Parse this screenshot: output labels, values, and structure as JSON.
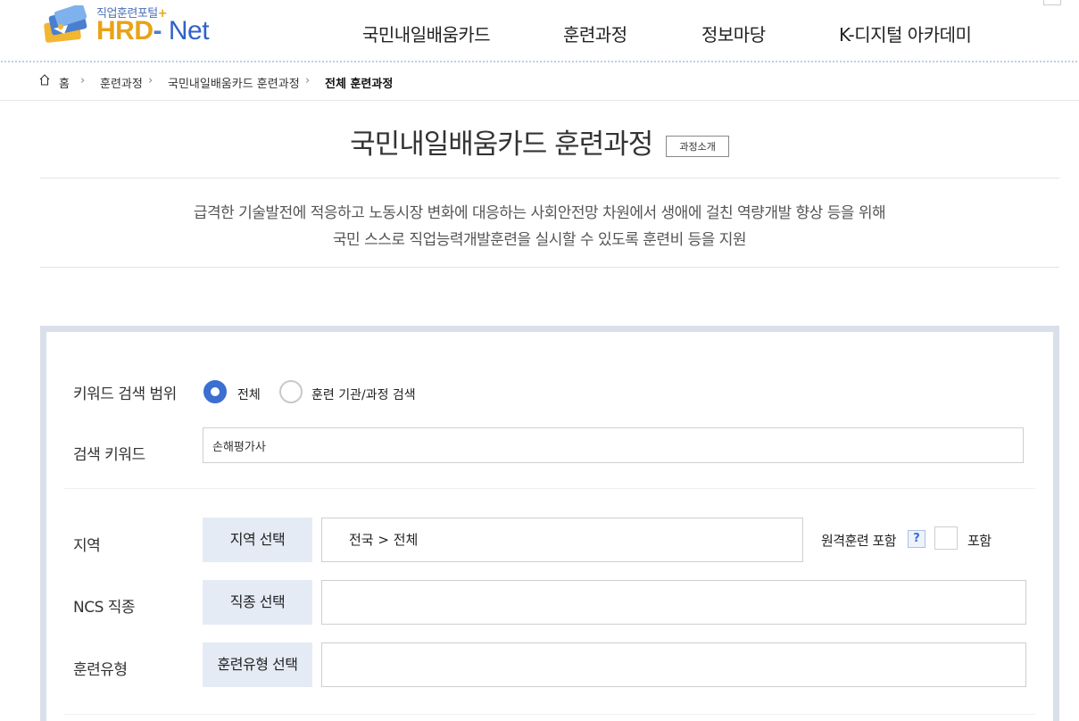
{
  "header": {
    "logo_small": "직업훈련포털",
    "logo_plus": "+",
    "logo_hrd": "HRD",
    "logo_dash": "-",
    "logo_net": "Net",
    "nav": [
      "국민내일배움카드",
      "훈련과정",
      "정보마당",
      "K-디지털 아카데미"
    ]
  },
  "breadcrumb": {
    "home": "홈",
    "items": [
      "훈련과정",
      "국민내일배움카드 훈련과정"
    ],
    "current": "전체 훈련과정"
  },
  "page": {
    "title": "국민내일배움카드 훈련과정",
    "intro_button": "과정소개",
    "desc_line1": "급격한 기술발전에 적응하고 노동시장 변화에 대응하는 사회안전망 차원에서 생애에 걸친 역량개발 향상 등을 위해",
    "desc_line2": "국민 스스로 직업능력개발훈련을 실시할 수 있도록 훈련비 등을 지원"
  },
  "search": {
    "scope_label": "키워드 검색 범위",
    "scope_options": [
      {
        "label": "전체",
        "selected": true
      },
      {
        "label": "훈련 기관/과정 검색",
        "selected": false
      }
    ],
    "keyword_label": "검색 키워드",
    "keyword_value": "손해평가사",
    "region_label": "지역",
    "region_button": "지역 선택",
    "region_value": "전국 > 전체",
    "remote_label": "원격훈련 포함",
    "remote_help": "?",
    "remote_check_label": "포함",
    "remote_checked": false,
    "ncs_label": "NCS 직종",
    "ncs_button": "직종 선택",
    "ncs_value": "",
    "type_label": "훈련유형",
    "type_button": "훈련유형 선택",
    "type_value": ""
  }
}
